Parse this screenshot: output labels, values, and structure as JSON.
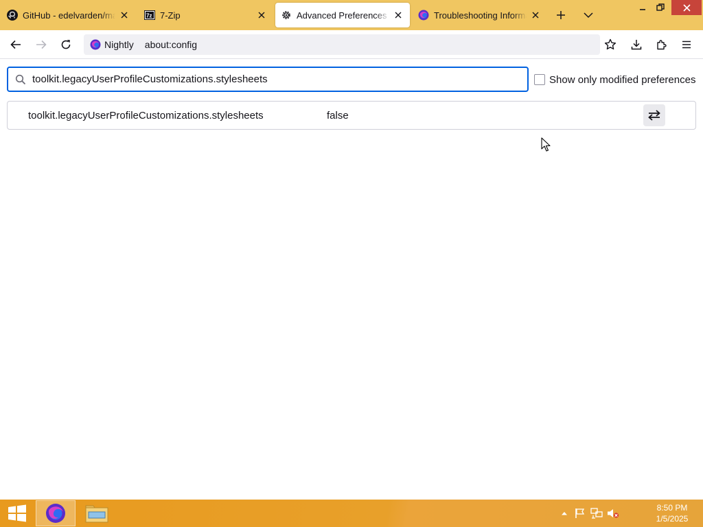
{
  "tabs": [
    {
      "title": "GitHub - edelvarden/material-fox-updated",
      "icon": "github-icon",
      "active": false
    },
    {
      "title": "7-Zip",
      "icon": "7zip-icon",
      "active": false
    },
    {
      "title": "Advanced Preferences",
      "icon": "gear-icon",
      "active": true
    },
    {
      "title": "Troubleshooting Information",
      "icon": "nightly-icon",
      "active": false
    }
  ],
  "navbar": {
    "identity_label": "Nightly",
    "url": "about:config"
  },
  "config": {
    "search_value": "toolkit.legacyUserProfileCustomizations.stylesheets",
    "show_modified_label": "Show only modified preferences",
    "show_modified_checked": false,
    "prefs": [
      {
        "name": "toolkit.legacyUserProfileCustomizations.stylesheets",
        "value": "false"
      }
    ]
  },
  "taskbar": {
    "time": "8:50 PM",
    "date": "1/5/2025"
  },
  "colors": {
    "tabstrip": "#f0c661",
    "taskbar": "#e89a1e",
    "focus_ring": "#0061e0"
  }
}
